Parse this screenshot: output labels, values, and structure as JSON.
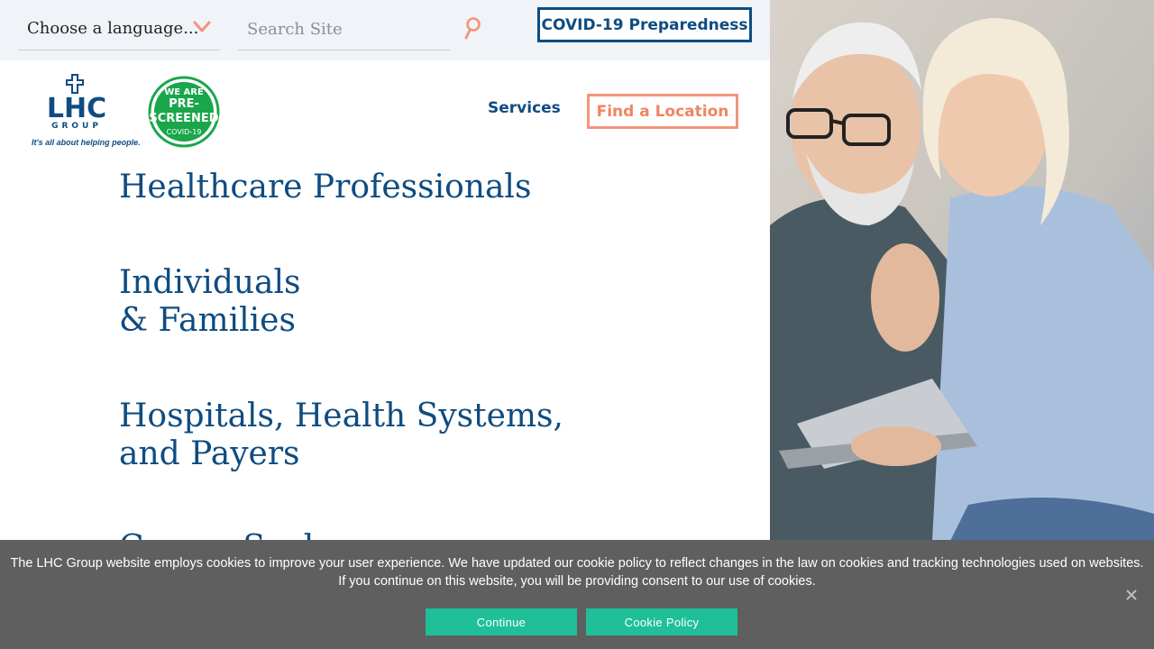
{
  "topbar": {
    "language_select": "Choose a language...",
    "search_placeholder": "Search Site",
    "covid_button": "COVID-19 Preparedness"
  },
  "header": {
    "logo_text": "LHC",
    "logo_group": "GROUP",
    "logo_tagline": "It's all about helping people.",
    "badge_top": "WE ARE",
    "badge_pre": "PRE-",
    "badge_main": "SCREENED",
    "badge_bottom": "COVID-19",
    "nav_services": "Services",
    "find_location_button": "Find a Location"
  },
  "audiences": [
    {
      "line1": "Healthcare Professionals",
      "line2": ""
    },
    {
      "line1": "Individuals",
      "line2": "& Families"
    },
    {
      "line1": "Hospitals, Health Systems,",
      "line2": "and Payers"
    },
    {
      "line1": "Career Seekers",
      "line2": ""
    }
  ],
  "cookie_banner": {
    "line1": "The LHC Group website employs cookies to improve your user experience. We have updated our cookie policy to reflect changes in the law on cookies and tracking technologies used on websites.",
    "line2": "If you continue on this website, you will be providing consent to our use of cookies.",
    "continue_button": "Continue",
    "policy_button": "Cookie Policy"
  },
  "colors": {
    "brand_blue": "#0f4c81",
    "accent_coral": "#f08461",
    "cookie_green": "#1fbf98",
    "badge_green": "#1aa64a"
  },
  "icons": {
    "chevron": "chevron-down-icon",
    "search": "search-icon",
    "close": "close-icon"
  }
}
